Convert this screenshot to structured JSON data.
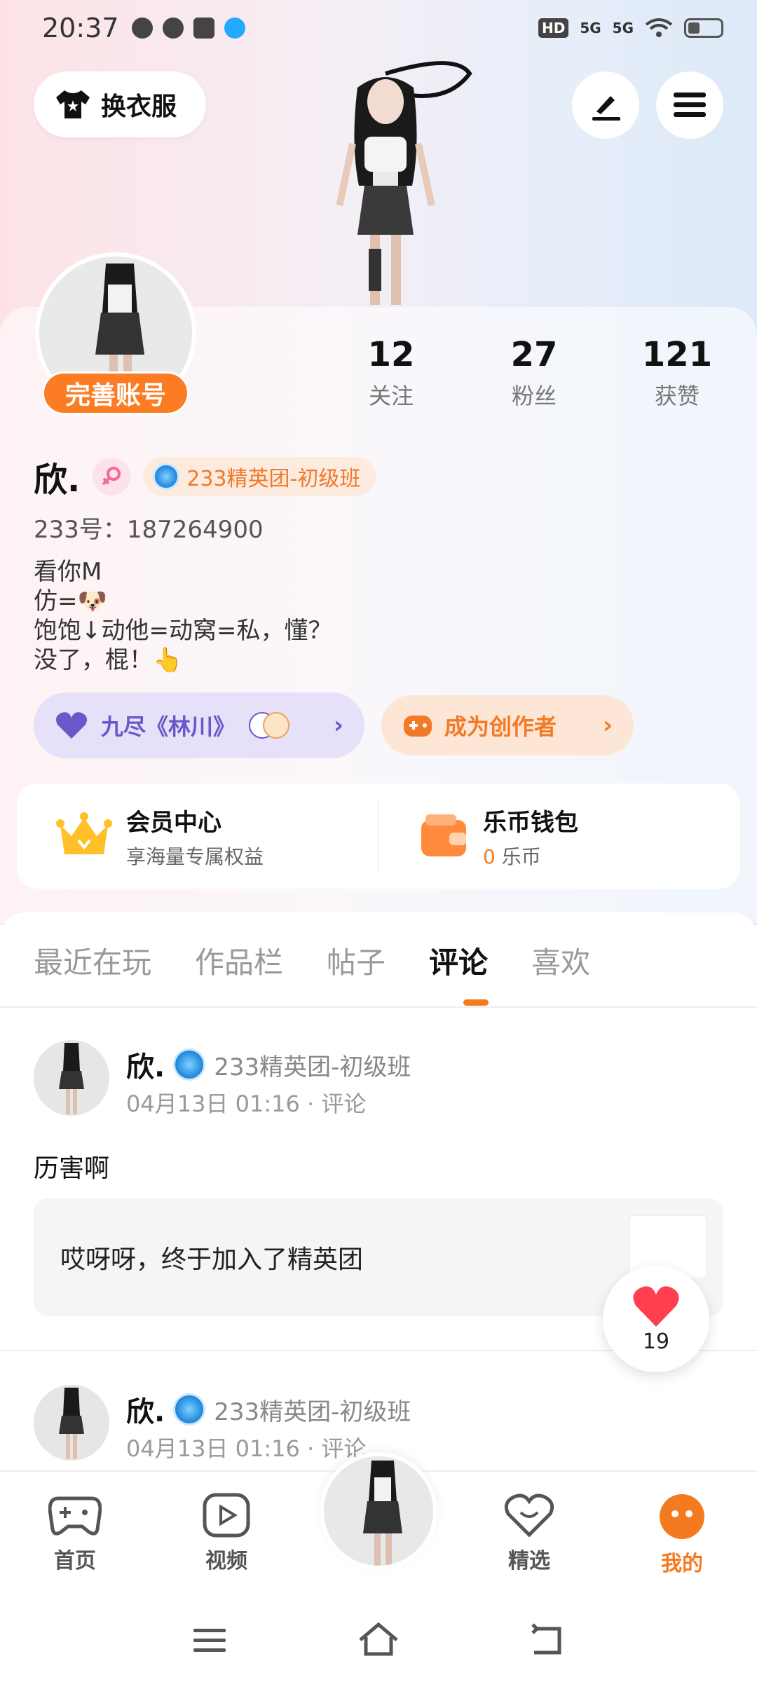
{
  "status_bar": {
    "time": "20:37",
    "hd": "HD",
    "signal1": "5G",
    "signal2": "5G"
  },
  "header": {
    "outfit_label": "换衣服"
  },
  "profile": {
    "complete_label": "完善账号",
    "stats": [
      {
        "num": "12",
        "label": "关注"
      },
      {
        "num": "27",
        "label": "粉丝"
      },
      {
        "num": "121",
        "label": "获赞"
      }
    ],
    "name": "欣.",
    "badge": "233精英团-初级班",
    "uid": "233号：187264900",
    "bio": [
      "看你M",
      "仿=🐶",
      "饱饱↓动他=动窝=私，懂？",
      "没了，棍！👆"
    ],
    "pill_purple": "九尽《林川》",
    "pill_orange": "成为创作者",
    "vip": {
      "title": "会员中心",
      "sub": "享海量专属权益"
    },
    "wallet": {
      "title": "乐币钱包",
      "amount": "0",
      "unit": "乐币"
    }
  },
  "tabs": [
    {
      "label": "最近在玩"
    },
    {
      "label": "作品栏"
    },
    {
      "label": "帖子"
    },
    {
      "label": "评论"
    },
    {
      "label": "喜欢"
    }
  ],
  "comments": [
    {
      "name": "欣.",
      "group": "233精英团-初级班",
      "meta": "04月13日 01:16 · 评论",
      "text": "历害啊",
      "quote": "哎呀呀，终于加入了精英团"
    },
    {
      "name": "欣.",
      "group": "233精英团-初级班",
      "meta": "04月13日 01:16 · 评论"
    }
  ],
  "like_float": {
    "count": "19"
  },
  "bottom_nav": [
    {
      "label": "首页"
    },
    {
      "label": "视频"
    },
    {
      "label": "精选"
    },
    {
      "label": "我的"
    }
  ],
  "colors": {
    "accent": "#f47a20",
    "purple": "#6a58c9"
  }
}
